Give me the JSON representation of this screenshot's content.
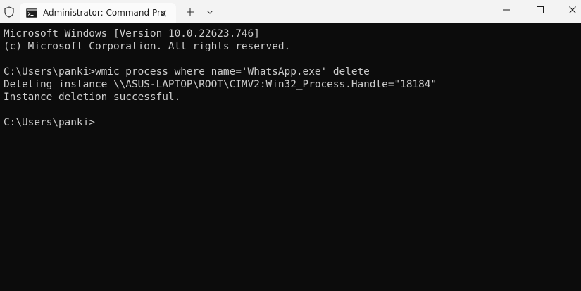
{
  "window": {
    "tab_title": "Administrator: Command Pro",
    "icons": {
      "shield": "shield-icon",
      "tab": "command-prompt-icon",
      "close_tab": "close-icon",
      "new_tab": "plus-icon",
      "dropdown": "chevron-down-icon",
      "minimize": "minimize-icon",
      "maximize": "maximize-icon",
      "close_window": "close-icon"
    }
  },
  "terminal": {
    "lines": [
      "Microsoft Windows [Version 10.0.22623.746]",
      "(c) Microsoft Corporation. All rights reserved.",
      "",
      "C:\\Users\\panki>wmic process where name='WhatsApp.exe' delete",
      "Deleting instance \\\\ASUS-LAPTOP\\ROOT\\CIMV2:Win32_Process.Handle=\"18184\"",
      "Instance deletion successful.",
      "",
      "C:\\Users\\panki>"
    ]
  },
  "colors": {
    "terminal_background": "#0c0c0c",
    "terminal_text": "#cccccc",
    "titlebar_background": "#f3f3f3",
    "active_tab_background": "#fbfbfb"
  }
}
